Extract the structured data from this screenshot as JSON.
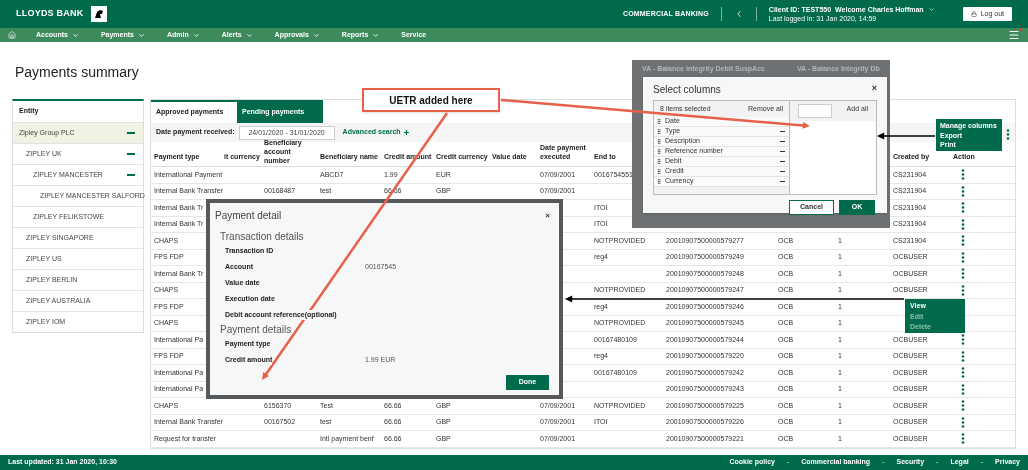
{
  "header": {
    "brand": "LLOYDS BANK",
    "division": "COMMERCIAL BANKING",
    "client_id": "Client ID: TEST550",
    "welcome": "Welcome Charles Hoffman",
    "last_login": "Last logged in: 31 Jan 2020, 14:59",
    "logout": "Log out"
  },
  "nav": [
    {
      "label": "Accounts",
      "dropdown": true
    },
    {
      "label": "Payments",
      "dropdown": true
    },
    {
      "label": "Admin",
      "dropdown": true
    },
    {
      "label": "Alerts",
      "dropdown": true
    },
    {
      "label": "Approvals",
      "dropdown": true
    },
    {
      "label": "Reports",
      "dropdown": true
    },
    {
      "label": "Service",
      "dropdown": false
    }
  ],
  "page_title": "Payments summary",
  "sidebar": {
    "heading": "Entity",
    "items": [
      {
        "label": "Zipley Group PLC",
        "selected": true,
        "expanded": true,
        "children": [
          {
            "label": "ZIPLEY UK",
            "selected": false,
            "expanded": true,
            "children": [
              {
                "label": "ZIPLEY MANCESTER",
                "selected": false,
                "expanded": true,
                "children": [
                  {
                    "label": "ZIPLEY MANCESTER SALFORD",
                    "selected": false,
                    "expanded": false
                  }
                ]
              },
              {
                "label": "ZIPLEY FELIKSTOWE",
                "selected": false,
                "expanded": false
              }
            ]
          },
          {
            "label": "ZIPLEY SINGAPORE",
            "selected": false,
            "expanded": false
          },
          {
            "label": "ZIPLEY US",
            "selected": false,
            "expanded": false
          },
          {
            "label": "ZIPLEY BERLIN",
            "selected": false,
            "expanded": false
          },
          {
            "label": "ZIPLEY AUSTRALIA",
            "selected": false,
            "expanded": false
          },
          {
            "label": "ZIPLEY IOM",
            "selected": false,
            "expanded": false
          }
        ]
      }
    ]
  },
  "tabs": [
    {
      "label": "Approved payments",
      "selected": true
    },
    {
      "label": "Pending payments",
      "selected": false
    }
  ],
  "filter": {
    "label": "Date payment received:",
    "value": "24/01/2020 - 31/01/2020",
    "advanced_search": "Advanced search"
  },
  "table": {
    "columns": [
      "Payment type",
      "it currency",
      "Beneficiary account number",
      "Beneficiary name",
      "Credit amount",
      "Credit currency",
      "Value date",
      "Date payment executed",
      "End to",
      null,
      null,
      null,
      "Created by",
      "Action"
    ],
    "rows": [
      [
        "International Payment",
        null,
        null,
        "ABCD7",
        "1.99",
        "EUR",
        null,
        "07/09/2001",
        "0016754551",
        null,
        null,
        null,
        "CS231904"
      ],
      [
        "Internal Bank Transfer",
        null,
        "00168487",
        "test",
        "66.66",
        "GBP",
        null,
        "07/09/2001",
        null,
        null,
        null,
        null,
        "CS231904"
      ],
      [
        "Internal Bank Tr",
        null,
        null,
        null,
        null,
        null,
        null,
        null,
        "ITOI",
        null,
        null,
        null,
        "CS231904"
      ],
      [
        "Internal Bank Tr",
        null,
        null,
        null,
        null,
        null,
        null,
        null,
        "ITOI",
        null,
        null,
        null,
        "CS231904"
      ],
      [
        "CHAPS",
        null,
        null,
        null,
        null,
        null,
        null,
        null,
        "NOTPROVIDED",
        "20010907500000579277",
        "OCB",
        "1",
        "CS231904"
      ],
      [
        "FPS FDP",
        null,
        null,
        null,
        null,
        null,
        null,
        null,
        "reg4",
        "20010907500000579249",
        "OCB",
        "1",
        "OCBUSER"
      ],
      [
        "Internal Bank Tr",
        null,
        null,
        null,
        null,
        null,
        null,
        null,
        null,
        "20010907500000579248",
        "OCB",
        "1",
        "OCBUSER"
      ],
      [
        "CHAPS",
        null,
        null,
        null,
        null,
        null,
        null,
        null,
        "NOTPROVIDED",
        "20010907500000579247",
        "OCB",
        "1",
        "OCBUSER"
      ],
      [
        "FPS FDP",
        null,
        null,
        null,
        null,
        null,
        null,
        null,
        "reg4",
        "20010907500000579246",
        "OCB",
        "1",
        null
      ],
      [
        "CHAPS",
        null,
        null,
        null,
        null,
        null,
        null,
        null,
        "NOTPROVIDED",
        "20010907500000579245",
        "OCB",
        "1",
        null
      ],
      [
        "International Pa",
        null,
        null,
        null,
        null,
        null,
        null,
        null,
        "00167480109",
        "20010907500000579244",
        "OCB",
        "1",
        "OCBUSER"
      ],
      [
        "FPS FDP",
        null,
        null,
        null,
        null,
        null,
        null,
        null,
        "reg4",
        "20010907500000579220",
        "OCB",
        "1",
        "OCBUSER"
      ],
      [
        "International Pa",
        null,
        null,
        null,
        null,
        null,
        null,
        null,
        "00167480109",
        "20010907500000579242",
        "OCB",
        "1",
        "OCBUSER"
      ],
      [
        "International Pa",
        null,
        null,
        null,
        null,
        null,
        null,
        null,
        null,
        "20010907500000579243",
        "OCB",
        "1",
        "OCBUSER"
      ],
      [
        "CHAPS",
        null,
        "6156370",
        "Test",
        "66.66",
        "GBP",
        null,
        "07/09/2001",
        "NOTPROVIDED",
        "20010907500000579225",
        "OCB",
        "1",
        "OCBUSER"
      ],
      [
        "Internal Bank Transfer",
        null,
        "00167502",
        "test",
        "66.66",
        "GBP",
        null,
        "07/09/2001",
        "ITOI",
        "20010907500000579226",
        "OCB",
        "1",
        "OCBUSER"
      ],
      [
        "Request for transfer",
        null,
        null,
        "Intl payment benf",
        "66.66",
        "GBP",
        null,
        "07/09/2001",
        null,
        "20010907500000579221",
        "OCB",
        "1",
        "OCBUSER"
      ]
    ]
  },
  "footer": {
    "updated": "Last updated: 31 Jan 2020, 10:30",
    "links": [
      "Cookie policy",
      "Commercial banking",
      "Security",
      "Legal",
      "Privacy"
    ],
    "separator": "-"
  },
  "backdrop_tabs": [
    "VA - Balance Integrity Debit SuspAcc",
    "VA - Balance Integrity Db"
  ],
  "select_columns": {
    "title": "Select columns",
    "close": "×",
    "selected_count": "8 items selected",
    "remove_all": "Remove all",
    "add_all": "Add all",
    "items": [
      {
        "label": "Date",
        "removable": false
      },
      {
        "label": "Type",
        "removable": true
      },
      {
        "label": "Description",
        "removable": true
      },
      {
        "label": "Reference number",
        "removable": true
      },
      {
        "label": "Debit",
        "removable": true
      },
      {
        "label": "Credit",
        "removable": true
      },
      {
        "label": "Currency",
        "removable": true
      }
    ],
    "buttons": [
      {
        "label": "Cancel",
        "kind": "secondary"
      },
      {
        "label": "OK",
        "kind": "primary"
      }
    ]
  },
  "column_menu": [
    {
      "label": "Manage columns",
      "disabled": false
    },
    {
      "label": "Export",
      "disabled": false
    },
    {
      "label": "Print",
      "disabled": false
    }
  ],
  "row_menu": [
    {
      "label": "View",
      "disabled": false
    },
    {
      "label": "Edit",
      "disabled": true
    },
    {
      "label": "Delete",
      "disabled": true
    }
  ],
  "payment_detail": {
    "title": "Payment detail",
    "close": "×",
    "sections": [
      {
        "heading": "Transaction details",
        "fields": [
          {
            "label": "Transaction ID"
          },
          {
            "label": "Account",
            "value": "00167545"
          },
          {
            "label": "Value date"
          },
          {
            "label": "Execution date"
          },
          {
            "label": "Debit account reference(optional)"
          }
        ]
      },
      {
        "heading": "Payment details",
        "fields": [
          {
            "label": "Payment type"
          },
          {
            "label": "Credit amount",
            "value": "1.99 EUR"
          }
        ]
      }
    ],
    "button": "Done"
  },
  "callout": "UETR added here"
}
